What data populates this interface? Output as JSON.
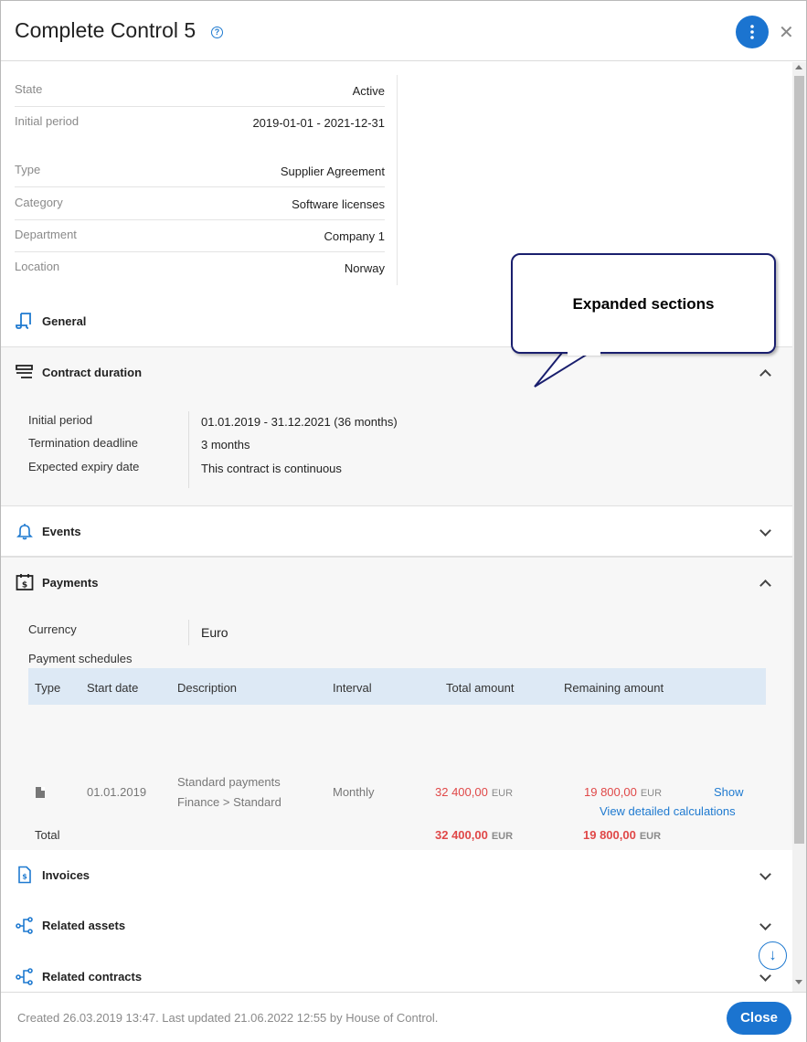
{
  "header": {
    "title": "Complete Control 5",
    "help_icon": "question-circle-icon",
    "menu_icon": "more-vertical-icon",
    "close_glyph": "✕"
  },
  "properties": [
    {
      "label": "State",
      "value": "Active"
    },
    {
      "label": "Initial period",
      "value": "2019-01-01 - 2021-12-31"
    },
    {
      "label": "Type",
      "value": "Supplier Agreement"
    },
    {
      "label": "Category",
      "value": "Software licenses"
    },
    {
      "label": "Department",
      "value": "Company 1"
    },
    {
      "label": "Location",
      "value": "Norway"
    }
  ],
  "sections": {
    "general": {
      "title": "General",
      "icon": "document-icon"
    },
    "contract_duration": {
      "title": "Contract duration",
      "icon": "list-icon",
      "rows": [
        {
          "label": "Initial period",
          "value": "01.01.2019 - 31.12.2021 (36 months)"
        },
        {
          "label": "Termination deadline",
          "value": "3 months"
        },
        {
          "label": "Expected expiry date",
          "value": "This contract is continuous"
        }
      ]
    },
    "events": {
      "title": "Events",
      "icon": "bell-icon"
    },
    "payments": {
      "title": "Payments",
      "icon": "calendar-dollar-icon",
      "currency_label": "Currency",
      "currency_value": "Euro",
      "schedules_label": "Payment schedules",
      "table": {
        "headers": [
          "Type",
          "Start date",
          "Description",
          "Interval",
          "Total amount",
          "Remaining amount"
        ],
        "row": {
          "start_date": "01.01.2019",
          "description_line1": "Standard payments",
          "description_line2": "Finance > Standard",
          "interval": "Monthly",
          "total_amount": "32 400,00",
          "total_currency": "EUR",
          "remaining_amount": "19 800,00",
          "remaining_currency": "EUR",
          "action": "Show"
        },
        "total": {
          "label": "Total",
          "total_amount": "32 400,00",
          "total_currency": "EUR",
          "remaining_amount": "19 800,00",
          "remaining_currency": "EUR"
        }
      },
      "detail_link": "View detailed calculations"
    },
    "invoices": {
      "title": "Invoices",
      "icon": "invoice-icon"
    },
    "related_assets": {
      "title": "Related assets",
      "icon": "relations-icon"
    },
    "related_contracts": {
      "title": "Related contracts",
      "icon": "relations-icon"
    }
  },
  "callout": {
    "text": "Expanded sections"
  },
  "scroll_down_glyph": "↓",
  "footer": {
    "text": "Created 26.03.2019 13:47. Last updated 21.06.2022 12:55 by House of Control.",
    "close_label": "Close"
  },
  "colors": {
    "accent": "#1b74d0",
    "link": "#1f7ad0",
    "amount_red": "#e04848",
    "table_header": "#dde9f5",
    "expanded_bg": "#f7f7f7"
  }
}
